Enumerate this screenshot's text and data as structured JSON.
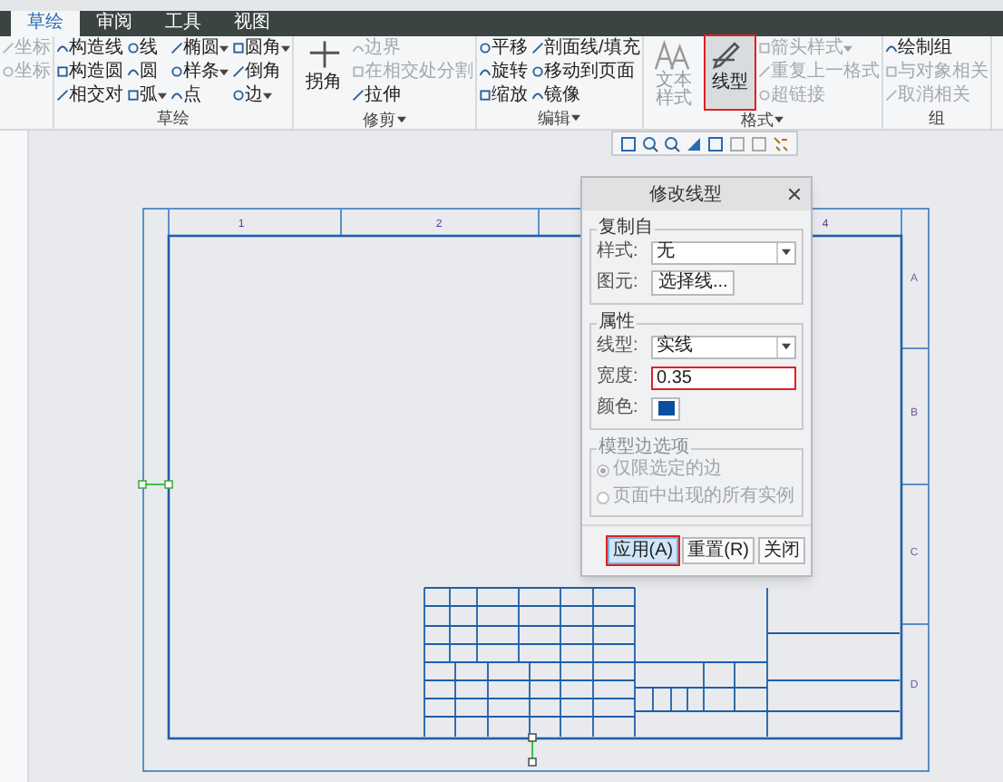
{
  "ribbon": {
    "tabs": [
      {
        "label": "草绘",
        "selected": true
      },
      {
        "label": "审阅",
        "selected": false
      },
      {
        "label": "工具",
        "selected": false
      },
      {
        "label": "视图",
        "selected": false
      }
    ],
    "groups": [
      {
        "columns": [
          [
            {
              "kind": "small",
              "label": "坐标",
              "disabled": true
            },
            {
              "kind": "small",
              "label": "坐标",
              "disabled": true
            }
          ]
        ]
      },
      {
        "label": "草绘",
        "columns": [
          [
            {
              "kind": "small",
              "label": "构造线"
            },
            {
              "kind": "small",
              "label": "构造圆"
            },
            {
              "kind": "small",
              "label": "相交对"
            }
          ],
          [
            {
              "kind": "small",
              "label": "线"
            },
            {
              "kind": "small",
              "label": "圆"
            },
            {
              "kind": "small",
              "label": "弧",
              "menu": true
            }
          ],
          [
            {
              "kind": "small",
              "label": "椭圆",
              "menu": true
            },
            {
              "kind": "small",
              "label": "样条",
              "menu": true
            },
            {
              "kind": "small",
              "label": "点"
            }
          ],
          [
            {
              "kind": "small",
              "label": "圆角",
              "menu": true
            },
            {
              "kind": "small",
              "label": "倒角"
            },
            {
              "kind": "small",
              "label": "边",
              "menu": true
            }
          ]
        ]
      },
      {
        "label": "修剪",
        "menu": true,
        "columns": [
          [
            {
              "kind": "large",
              "label": "拐角"
            }
          ],
          [
            {
              "kind": "small",
              "label": "边界",
              "disabled": true
            },
            {
              "kind": "small",
              "label": "在相交处分割",
              "disabled": true
            },
            {
              "kind": "small",
              "label": "拉伸"
            }
          ]
        ]
      },
      {
        "label": "编辑",
        "menu": true,
        "columns": [
          [
            {
              "kind": "small",
              "label": "平移"
            },
            {
              "kind": "small",
              "label": "旋转"
            },
            {
              "kind": "small",
              "label": "缩放"
            }
          ],
          [
            {
              "kind": "small",
              "label": "剖面线/填充"
            },
            {
              "kind": "small",
              "label": "移动到页面"
            },
            {
              "kind": "small",
              "label": "镜像"
            }
          ]
        ]
      },
      {
        "label": "格式",
        "menu": true,
        "columns": [
          [
            {
              "kind": "large",
              "label": "文本样式",
              "disabled": true
            }
          ],
          [
            {
              "kind": "large",
              "label": "线型",
              "selected": true,
              "highlighted": true
            }
          ],
          [
            {
              "kind": "small",
              "label": "箭头样式",
              "disabled": true,
              "menu": true
            },
            {
              "kind": "small",
              "label": "重复上一格式",
              "disabled": true
            },
            {
              "kind": "small",
              "label": "超链接",
              "disabled": true
            }
          ]
        ]
      },
      {
        "label": "组",
        "columns": [
          [
            {
              "kind": "small",
              "label": "绘制组"
            },
            {
              "kind": "small",
              "label": "与对象相关",
              "disabled": true
            },
            {
              "kind": "small",
              "label": "取消相关",
              "disabled": true
            }
          ]
        ]
      }
    ]
  },
  "sheet": {
    "column_labels": [
      "1",
      "2",
      "4"
    ],
    "row_labels": [
      "A",
      "B",
      "C",
      "D"
    ]
  },
  "dialog": {
    "title": "修改线型",
    "sections": [
      {
        "title": "复制自",
        "disabled": false,
        "fields": [
          {
            "kind": "select",
            "label": "样式:",
            "value": "无"
          },
          {
            "kind": "button",
            "label": "图元:",
            "value": "选择线..."
          }
        ]
      },
      {
        "title": "属性",
        "disabled": false,
        "fields": [
          {
            "kind": "select",
            "label": "线型:",
            "value": "实线"
          },
          {
            "kind": "input",
            "label": "宽度:",
            "value": "0.35",
            "highlighted": true
          },
          {
            "kind": "color",
            "label": "颜色:",
            "color": "#0a4f9e"
          }
        ]
      },
      {
        "title": "模型边选项",
        "disabled": true,
        "options": [
          {
            "label": "仅限选定的边",
            "selected": true
          },
          {
            "label": "页面中出现的所有实例",
            "selected": false
          }
        ]
      }
    ],
    "buttons": [
      {
        "label": "应用(A)",
        "primary": true,
        "highlighted": true
      },
      {
        "label": "重置(R)",
        "primary": false,
        "highlighted": false
      },
      {
        "label": "关闭",
        "primary": false,
        "highlighted": false
      }
    ]
  }
}
